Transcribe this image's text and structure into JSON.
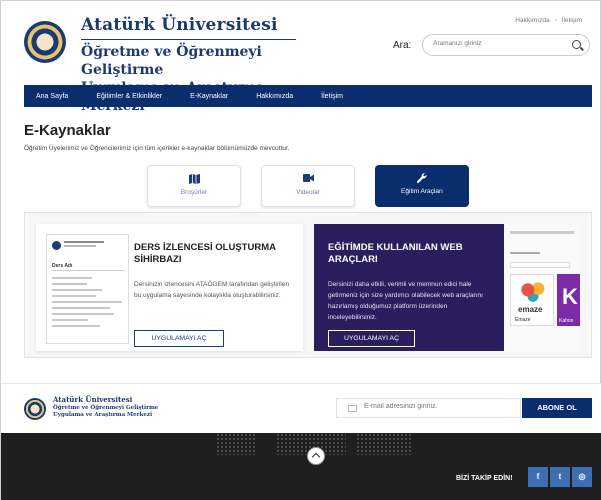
{
  "header": {
    "university": "Atatürk Üniversitesi",
    "center_line1": "Öğretme ve Öğrenmeyi Geliştirme",
    "center_line2": "Uygulama ve Araştırma Merkezi",
    "top_links": [
      "Hakkımızda",
      "İletişim"
    ],
    "search_label": "Ara:",
    "search_placeholder": "Aramanızı giriniz"
  },
  "nav": {
    "items": [
      "Ana Sayfa",
      "Eğitimler & Etkinlikler",
      "E-Kaynaklar",
      "Hakkımızda",
      "İletişim"
    ]
  },
  "page": {
    "title": "E-Kaynaklar",
    "subtitle": "Öğretim Üyelerimiz ve Öğrencilerimiz için tüm içerikler e-kaynaklar bölümümüzde mevcuttur."
  },
  "tabs": [
    {
      "label": "Broşürler",
      "icon": "map-icon",
      "active": false
    },
    {
      "label": "Videolar",
      "icon": "video-icon",
      "active": false
    },
    {
      "label": "Eğitim Araçları",
      "icon": "wrench-icon",
      "active": true
    }
  ],
  "cards": [
    {
      "title": "DERS İZLENCESİ OLUŞTURMA SİHİRBAZI",
      "text": "Dersinizin izlencesini ATAÖGEM tarafından geliştirilen bu uygulama sayesinde kolaylıkla oluşturabilirsiniz.",
      "button": "UYGULAMAYI AÇ",
      "thumb_title": "Ders Adı"
    },
    {
      "title": "EĞİTİMDE KULLANILAN WEB ARAÇLARI",
      "text": "Dersinizi daha etkili, verimli ve memnun edici hale getirmeniz için size yardımcı olabilecek web araçlarını hazırlamış olduğumuz platform üzerinden inceleyebilirsiniz.",
      "button": "UYGULAMAYI AÇ",
      "tile1_word": "emaze",
      "tile1_caption": "Emaze",
      "tile2_letter": "K",
      "tile2_caption": "Kahoo"
    }
  ],
  "newsletter": {
    "university": "Atatürk Üniversitesi",
    "center_line1": "Öğretme ve Öğrenmeyi Geliştirme",
    "center_line2": "Uygulama ve Araştırma Merkezi",
    "email_placeholder": "E-mail adresinizi giriniz.",
    "subscribe": "ABONE OL"
  },
  "footer": {
    "follow": "BİZİ TAKİP EDİN!",
    "social": [
      {
        "name": "facebook-icon",
        "glyph": "f"
      },
      {
        "name": "twitter-icon",
        "glyph": "t"
      },
      {
        "name": "instagram-icon",
        "glyph": "◎"
      }
    ]
  },
  "colors": {
    "primary": "#0a2d6e",
    "card_dark": "#2a1e5e",
    "footer": "#1f1f1f",
    "social": "#3d6fb5"
  }
}
